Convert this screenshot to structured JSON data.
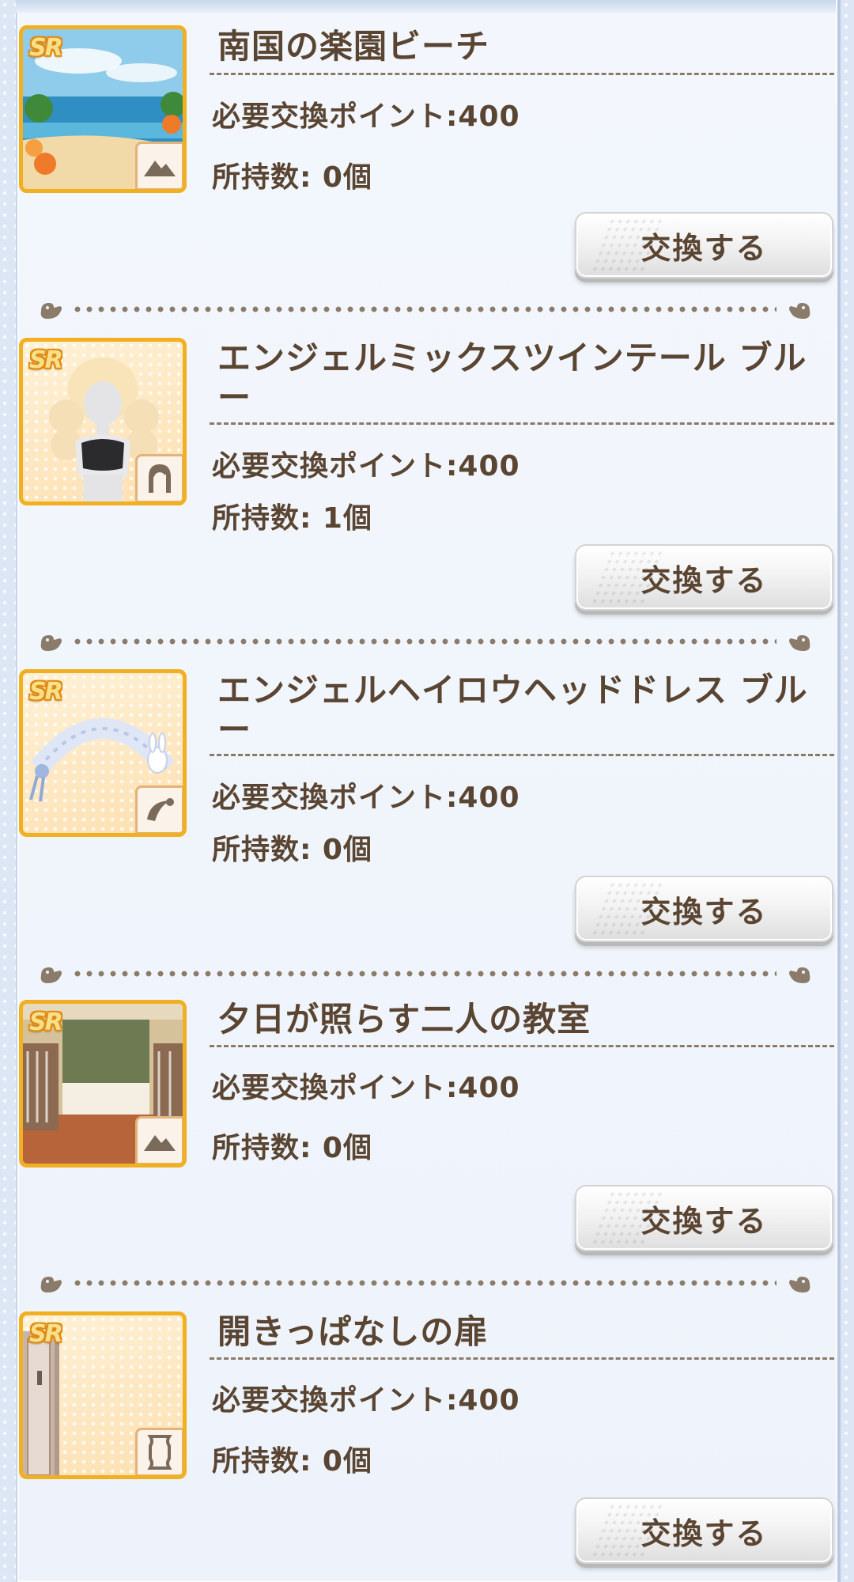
{
  "items": [
    {
      "title": "南国の楽園ビーチ",
      "points": "必要交換ポイント:400",
      "owned": "所持数: 0個",
      "button": "交換する",
      "rarity": "SR",
      "category_icon": "mountain-icon",
      "thumbnail": "beach"
    },
    {
      "title": "エンジェルミックスツインテール ブルー",
      "points": "必要交換ポイント:400",
      "owned": "所持数: 1個",
      "button": "交換する",
      "rarity": "SR",
      "category_icon": "hair-icon",
      "thumbnail": "twintail"
    },
    {
      "title": "エンジェルヘイロウヘッドドレス ブルー",
      "points": "必要交換ポイント:400",
      "owned": "所持数: 0個",
      "button": "交換する",
      "rarity": "SR",
      "category_icon": "headdress-icon",
      "thumbnail": "halo"
    },
    {
      "title": "夕日が照らす二人の教室",
      "points": "必要交換ポイント:400",
      "owned": "所持数: 0個",
      "button": "交換する",
      "rarity": "SR",
      "category_icon": "mountain-icon",
      "thumbnail": "classroom"
    },
    {
      "title": "開きっぱなしの扉",
      "points": "必要交換ポイント:400",
      "owned": "所持数: 0個",
      "button": "交換する",
      "rarity": "SR",
      "category_icon": "frame-icon",
      "thumbnail": "door"
    }
  ],
  "colors": {
    "text": "#5a4532",
    "frame_gold": "#f0b021",
    "panel": "#eef3fb"
  }
}
